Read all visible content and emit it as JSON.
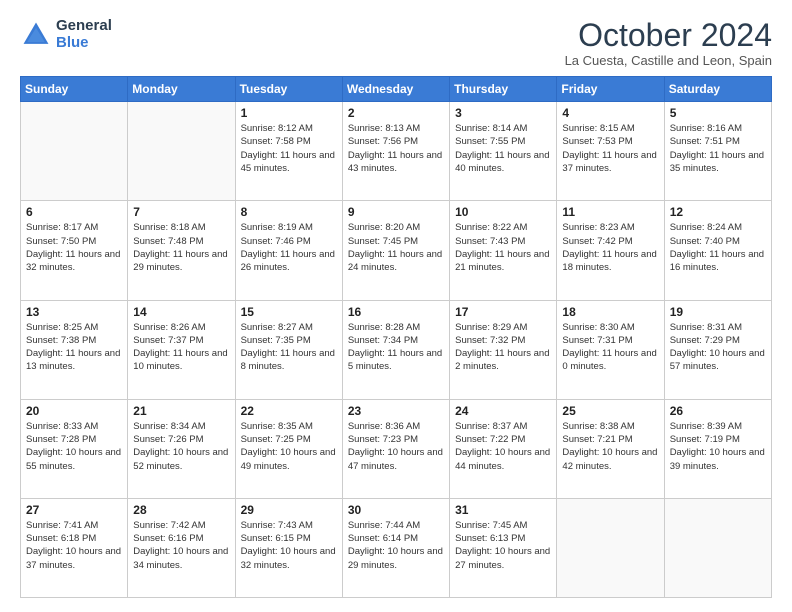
{
  "header": {
    "logo_line1": "General",
    "logo_line2": "Blue",
    "month_title": "October 2024",
    "location": "La Cuesta, Castille and Leon, Spain"
  },
  "days_of_week": [
    "Sunday",
    "Monday",
    "Tuesday",
    "Wednesday",
    "Thursday",
    "Friday",
    "Saturday"
  ],
  "weeks": [
    [
      {
        "day": "",
        "info": ""
      },
      {
        "day": "",
        "info": ""
      },
      {
        "day": "1",
        "info": "Sunrise: 8:12 AM\nSunset: 7:58 PM\nDaylight: 11 hours and 45 minutes."
      },
      {
        "day": "2",
        "info": "Sunrise: 8:13 AM\nSunset: 7:56 PM\nDaylight: 11 hours and 43 minutes."
      },
      {
        "day": "3",
        "info": "Sunrise: 8:14 AM\nSunset: 7:55 PM\nDaylight: 11 hours and 40 minutes."
      },
      {
        "day": "4",
        "info": "Sunrise: 8:15 AM\nSunset: 7:53 PM\nDaylight: 11 hours and 37 minutes."
      },
      {
        "day": "5",
        "info": "Sunrise: 8:16 AM\nSunset: 7:51 PM\nDaylight: 11 hours and 35 minutes."
      }
    ],
    [
      {
        "day": "6",
        "info": "Sunrise: 8:17 AM\nSunset: 7:50 PM\nDaylight: 11 hours and 32 minutes."
      },
      {
        "day": "7",
        "info": "Sunrise: 8:18 AM\nSunset: 7:48 PM\nDaylight: 11 hours and 29 minutes."
      },
      {
        "day": "8",
        "info": "Sunrise: 8:19 AM\nSunset: 7:46 PM\nDaylight: 11 hours and 26 minutes."
      },
      {
        "day": "9",
        "info": "Sunrise: 8:20 AM\nSunset: 7:45 PM\nDaylight: 11 hours and 24 minutes."
      },
      {
        "day": "10",
        "info": "Sunrise: 8:22 AM\nSunset: 7:43 PM\nDaylight: 11 hours and 21 minutes."
      },
      {
        "day": "11",
        "info": "Sunrise: 8:23 AM\nSunset: 7:42 PM\nDaylight: 11 hours and 18 minutes."
      },
      {
        "day": "12",
        "info": "Sunrise: 8:24 AM\nSunset: 7:40 PM\nDaylight: 11 hours and 16 minutes."
      }
    ],
    [
      {
        "day": "13",
        "info": "Sunrise: 8:25 AM\nSunset: 7:38 PM\nDaylight: 11 hours and 13 minutes."
      },
      {
        "day": "14",
        "info": "Sunrise: 8:26 AM\nSunset: 7:37 PM\nDaylight: 11 hours and 10 minutes."
      },
      {
        "day": "15",
        "info": "Sunrise: 8:27 AM\nSunset: 7:35 PM\nDaylight: 11 hours and 8 minutes."
      },
      {
        "day": "16",
        "info": "Sunrise: 8:28 AM\nSunset: 7:34 PM\nDaylight: 11 hours and 5 minutes."
      },
      {
        "day": "17",
        "info": "Sunrise: 8:29 AM\nSunset: 7:32 PM\nDaylight: 11 hours and 2 minutes."
      },
      {
        "day": "18",
        "info": "Sunrise: 8:30 AM\nSunset: 7:31 PM\nDaylight: 11 hours and 0 minutes."
      },
      {
        "day": "19",
        "info": "Sunrise: 8:31 AM\nSunset: 7:29 PM\nDaylight: 10 hours and 57 minutes."
      }
    ],
    [
      {
        "day": "20",
        "info": "Sunrise: 8:33 AM\nSunset: 7:28 PM\nDaylight: 10 hours and 55 minutes."
      },
      {
        "day": "21",
        "info": "Sunrise: 8:34 AM\nSunset: 7:26 PM\nDaylight: 10 hours and 52 minutes."
      },
      {
        "day": "22",
        "info": "Sunrise: 8:35 AM\nSunset: 7:25 PM\nDaylight: 10 hours and 49 minutes."
      },
      {
        "day": "23",
        "info": "Sunrise: 8:36 AM\nSunset: 7:23 PM\nDaylight: 10 hours and 47 minutes."
      },
      {
        "day": "24",
        "info": "Sunrise: 8:37 AM\nSunset: 7:22 PM\nDaylight: 10 hours and 44 minutes."
      },
      {
        "day": "25",
        "info": "Sunrise: 8:38 AM\nSunset: 7:21 PM\nDaylight: 10 hours and 42 minutes."
      },
      {
        "day": "26",
        "info": "Sunrise: 8:39 AM\nSunset: 7:19 PM\nDaylight: 10 hours and 39 minutes."
      }
    ],
    [
      {
        "day": "27",
        "info": "Sunrise: 7:41 AM\nSunset: 6:18 PM\nDaylight: 10 hours and 37 minutes."
      },
      {
        "day": "28",
        "info": "Sunrise: 7:42 AM\nSunset: 6:16 PM\nDaylight: 10 hours and 34 minutes."
      },
      {
        "day": "29",
        "info": "Sunrise: 7:43 AM\nSunset: 6:15 PM\nDaylight: 10 hours and 32 minutes."
      },
      {
        "day": "30",
        "info": "Sunrise: 7:44 AM\nSunset: 6:14 PM\nDaylight: 10 hours and 29 minutes."
      },
      {
        "day": "31",
        "info": "Sunrise: 7:45 AM\nSunset: 6:13 PM\nDaylight: 10 hours and 27 minutes."
      },
      {
        "day": "",
        "info": ""
      },
      {
        "day": "",
        "info": ""
      }
    ]
  ]
}
